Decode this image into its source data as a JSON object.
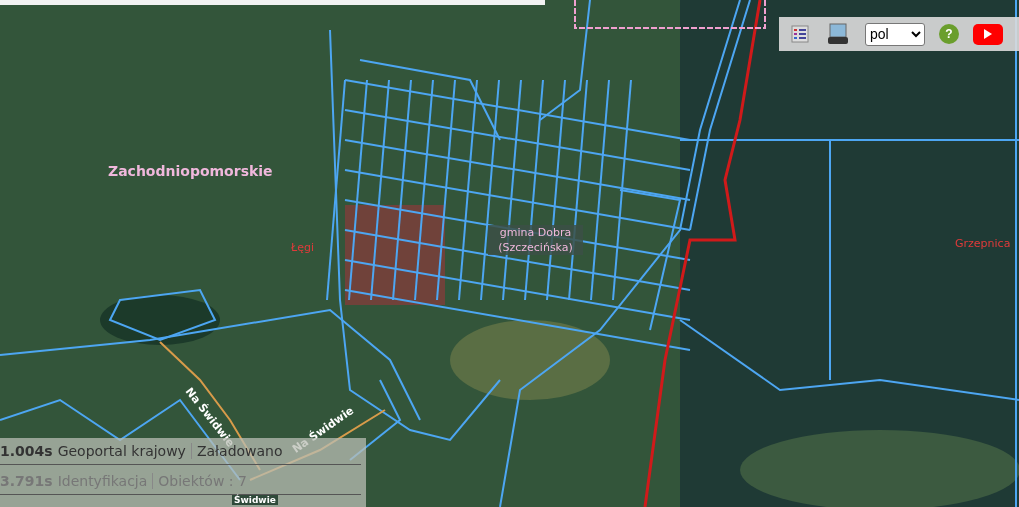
{
  "map": {
    "labels": [
      {
        "text": "Zachodniopomorskie",
        "kind": "region"
      },
      {
        "text": "Łęgi",
        "kind": "place"
      },
      {
        "text": "gmina Dobra (Szczecińska)",
        "kind": "commune"
      },
      {
        "text": "Grzepnica",
        "kind": "place"
      },
      {
        "text": "Na Świdwie",
        "kind": "road"
      },
      {
        "text": "Na Świdwie",
        "kind": "road"
      },
      {
        "text": "Świdwie",
        "kind": "road"
      }
    ]
  },
  "toolbar": {
    "language": "pol",
    "help": "?"
  },
  "status_rows": [
    {
      "time": "1.004s",
      "source": "Geoportal krajowy",
      "status": "Załadowano",
      "dimmed": false
    },
    {
      "time": "3.791s",
      "source": "Identyfikacja",
      "status": "Obiektów : 7",
      "dimmed": true
    }
  ]
}
